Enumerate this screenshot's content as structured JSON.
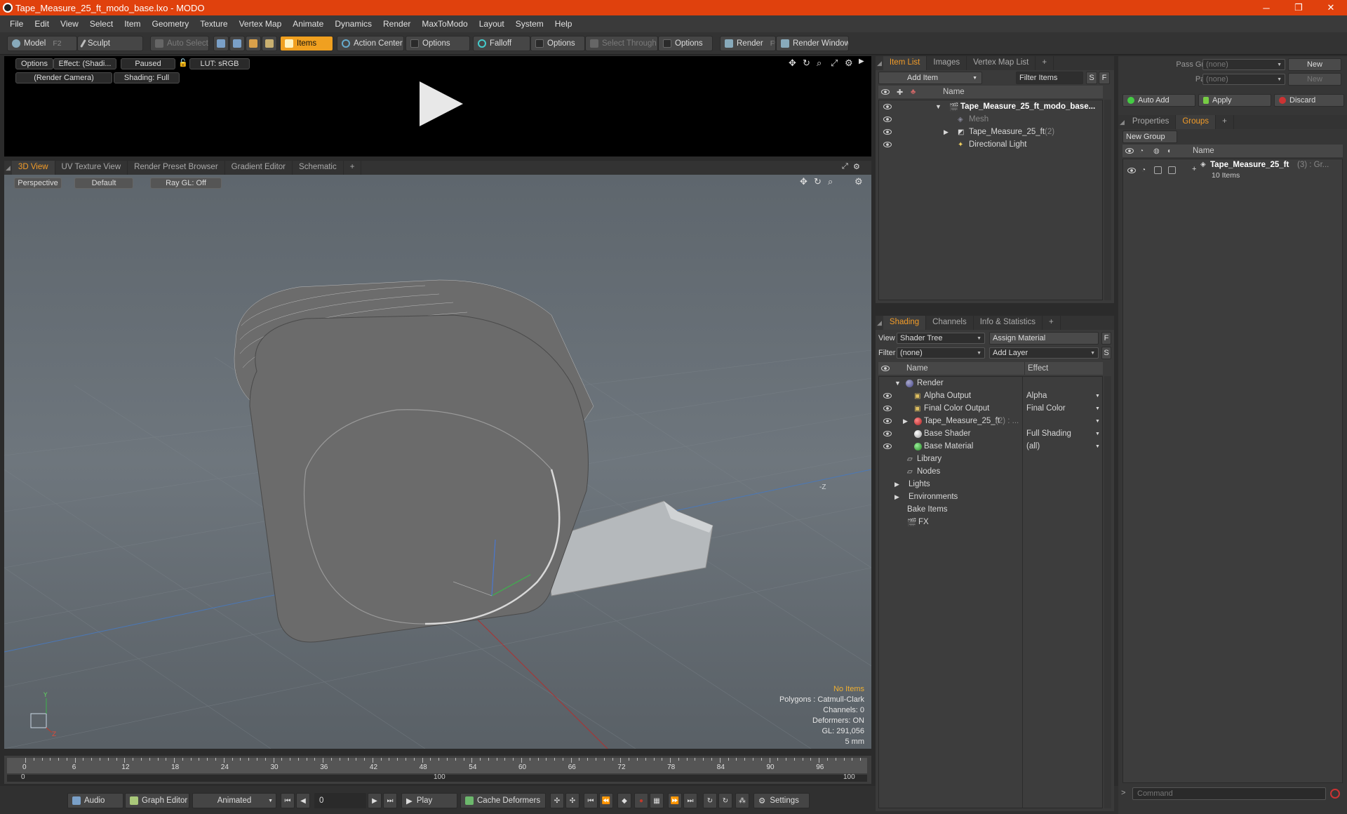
{
  "window": {
    "title": "Tape_Measure_25_ft_modo_base.lxo - MODO",
    "min": "─",
    "restore": "❐",
    "close": "✕"
  },
  "menu": [
    "File",
    "Edit",
    "View",
    "Select",
    "Item",
    "Geometry",
    "Texture",
    "Vertex Map",
    "Animate",
    "Dynamics",
    "Render",
    "MaxToModo",
    "Layout",
    "System",
    "Help"
  ],
  "toolbar": {
    "model": "Model",
    "model_key": "F2",
    "sculpt": "Sculpt",
    "auto_select": "Auto Select",
    "items": "Items",
    "action_center": "Action Center",
    "options1": "Options",
    "falloff": "Falloff",
    "options2": "Options",
    "select_through": "Select Through",
    "options3": "Options",
    "render": "Render",
    "render_key": "F9",
    "render_window": "Render Window"
  },
  "preview": {
    "options": "Options",
    "effect": "Effect: (Shadi...",
    "paused": "Paused",
    "lut": "LUT: sRGB",
    "camera": "(Render Camera)",
    "shading": "Shading: Full"
  },
  "viewport_tabs": [
    "3D View",
    "UV Texture View",
    "Render Preset Browser",
    "Gradient Editor",
    "Schematic",
    "+"
  ],
  "viewport": {
    "perspective": "Perspective",
    "default": "Default",
    "raygl": "Ray GL: Off",
    "axis_label": "-Z",
    "info": {
      "no_items": "No Items",
      "polygons": "Polygons : Catmull-Clark",
      "channels": "Channels: 0",
      "deformers": "Deformers: ON",
      "gl": "GL: 291,056",
      "unit": "5 mm"
    }
  },
  "timeline": {
    "ticks": [
      "0",
      "6",
      "12",
      "18",
      "24",
      "30",
      "36",
      "42",
      "48",
      "54",
      "60",
      "66",
      "72",
      "78",
      "84",
      "90",
      "96"
    ],
    "lower": [
      "0",
      "100",
      "100"
    ]
  },
  "bottombar": {
    "audio": "Audio",
    "graph_editor": "Graph Editor",
    "animated": "Animated",
    "frame": "0",
    "play": "Play",
    "cache": "Cache Deformers",
    "settings": "Settings"
  },
  "item_list": {
    "tabs": [
      "Item List",
      "Images",
      "Vertex Map List",
      "+"
    ],
    "add_item": "Add Item",
    "filter_items": "Filter Items",
    "s": "S",
    "f": "F",
    "col_name": "Name",
    "rows": [
      {
        "label": "Tape_Measure_25_ft_modo_base...",
        "count": ""
      },
      {
        "label": "Mesh",
        "count": ""
      },
      {
        "label": "Tape_Measure_25_ft",
        "count": "(2)"
      },
      {
        "label": "Directional Light",
        "count": ""
      }
    ]
  },
  "shading": {
    "tabs": [
      "Shading",
      "Channels",
      "Info & Statistics",
      "+"
    ],
    "view_label": "View",
    "view_value": "Shader Tree",
    "assign": "Assign Material",
    "f": "F",
    "filter_label": "Filter",
    "filter_value": "(none)",
    "add_layer": "Add Layer",
    "s": "S",
    "col_name": "Name",
    "col_effect": "Effect",
    "rows": [
      {
        "label": "Render",
        "effect": ""
      },
      {
        "label": "Alpha Output",
        "effect": "Alpha"
      },
      {
        "label": "Final Color Output",
        "effect": "Final Color"
      },
      {
        "label": "Tape_Measure_25_ft",
        "count": "(2) : ...",
        "effect": ""
      },
      {
        "label": "Base Shader",
        "effect": "Full Shading"
      },
      {
        "label": "Base Material",
        "effect": "(all)"
      },
      {
        "label": "Library",
        "effect": ""
      },
      {
        "label": "Nodes",
        "effect": ""
      },
      {
        "label": "Lights",
        "effect": ""
      },
      {
        "label": "Environments",
        "effect": ""
      },
      {
        "label": "Bake Items",
        "effect": ""
      },
      {
        "label": "FX",
        "effect": ""
      }
    ]
  },
  "groups_panel": {
    "pass_groups": "Pass Groups",
    "pass_groups_value": "(none)",
    "new1": "New",
    "passes": "Passes",
    "passes_value": "(none)",
    "new2": "New",
    "auto_add": "Auto Add",
    "apply": "Apply",
    "discard": "Discard",
    "tabs": [
      "Properties",
      "Groups",
      "+"
    ],
    "new_group": "New Group",
    "col_name": "Name",
    "group_name": "Tape_Measure_25_ft",
    "group_meta": "(3) : Gr...",
    "group_items": "10 Items",
    "command_placeholder": "Command"
  }
}
